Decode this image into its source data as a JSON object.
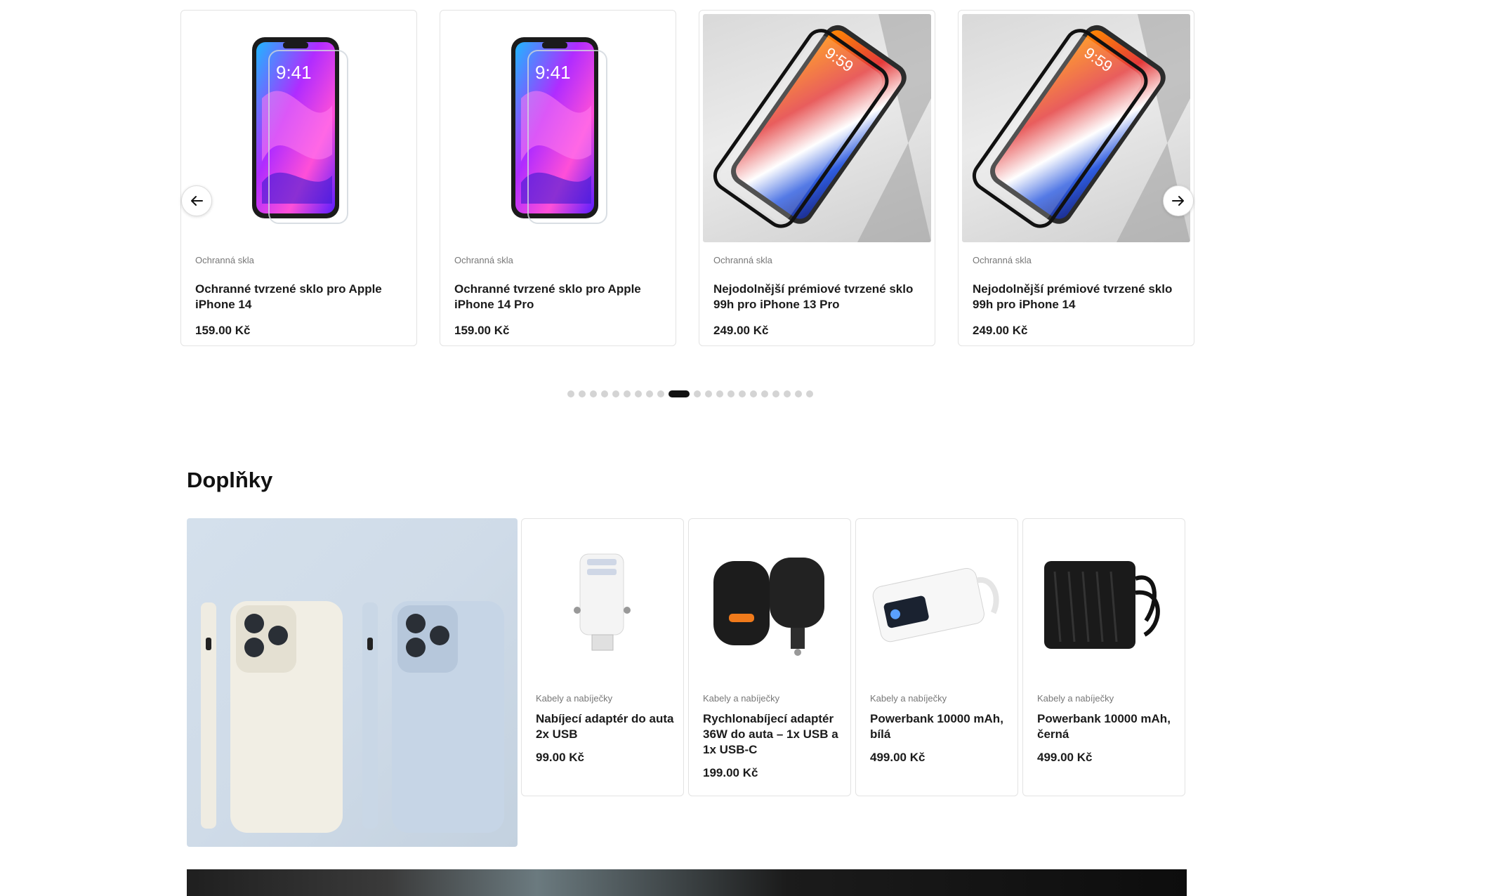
{
  "carousel": {
    "products": [
      {
        "category": "Ochranná skla",
        "name": "Ochranné tvrzené sklo pro Apple iPhone 14",
        "price": "159.00 Kč"
      },
      {
        "category": "Ochranná skla",
        "name": "Ochranné tvrzené sklo pro Apple iPhone 14 Pro",
        "price": "159.00 Kč"
      },
      {
        "category": "Ochranná skla",
        "name": "Nejodolnější prémiové tvrzené sklo 99h pro iPhone 13 Pro",
        "price": "249.00 Kč"
      },
      {
        "category": "Ochranná skla",
        "name": "Nejodolnější prémiové tvrzené sklo 99h pro iPhone 14",
        "price": "249.00 Kč"
      }
    ],
    "prev_icon": "arrow-left-icon",
    "next_icon": "arrow-right-icon",
    "active_page": 9,
    "page_count": 21
  },
  "accessories": {
    "title": "Doplňky",
    "products": [
      {
        "category": "Kabely a nabíječky",
        "name": "Nabíjecí adaptér do auta 2x USB",
        "price": "99.00 Kč"
      },
      {
        "category": "Kabely a nabíječky",
        "name": "Rychlonabíjecí adaptér 36W do auta – 1x USB a 1x USB-C",
        "price": "199.00 Kč"
      },
      {
        "category": "Kabely a nabíječky",
        "name": "Powerbank 10000 mAh, bílá",
        "price": "499.00 Kč"
      },
      {
        "category": "Kabely a nabíječky",
        "name": "Powerbank 10000 mAh, černá",
        "price": "499.00 Kč"
      }
    ]
  }
}
